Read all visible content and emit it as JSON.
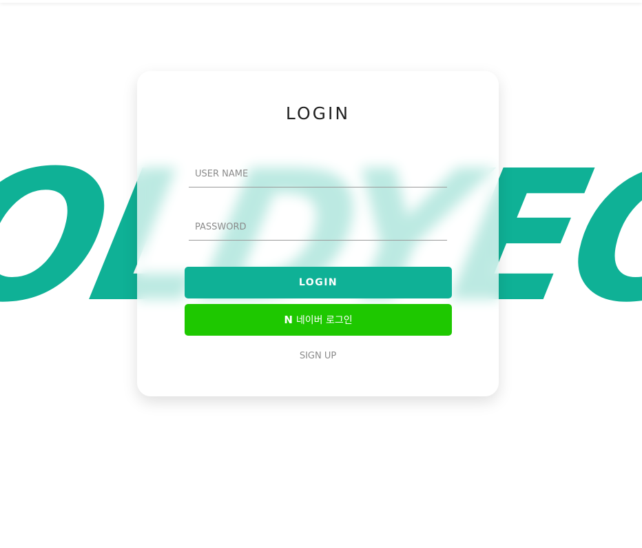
{
  "background": {
    "brand_text": "OLDYEON",
    "brand_color": "#0fb196"
  },
  "login_card": {
    "title": "LOGIN",
    "username_placeholder": "USER NAME",
    "password_placeholder": "PASSWORD",
    "login_button_label": "LOGIN",
    "naver_icon_glyph": "N",
    "naver_button_label": "네이버 로그인",
    "signup_link_label": "SIGN UP"
  },
  "colors": {
    "primary": "#0fb196",
    "naver_green": "#1ec800",
    "text_dark": "#222222",
    "text_muted": "#8a8a8a"
  },
  "icons": {
    "naver_logo": "naver-n-icon"
  }
}
